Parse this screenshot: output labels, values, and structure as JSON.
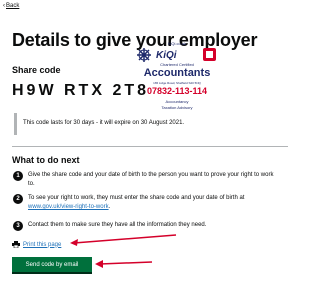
{
  "nav": {
    "back_label": "Back"
  },
  "page": {
    "title": "Details to give your employer",
    "share_code_label": "Share code",
    "share_code": "H9W RTX 2T8",
    "validity": "This code lasts for 30 days - it will expire on 30 August 2021."
  },
  "next": {
    "heading": "What to do next",
    "steps": [
      {
        "number": "1",
        "text": "Give the share code and your date of birth to the person you want to prove your right to work to."
      },
      {
        "number": "2",
        "text_before": "To see your right to work, they must enter the share code and your date of birth at ",
        "link": "www.gov.uk/view-right-to-work",
        "text_after": "."
      },
      {
        "number": "3",
        "text": "Contact them to make sure they have all the information they need."
      }
    ]
  },
  "actions": {
    "print_label": "Print this page",
    "print_icon": "printer-icon",
    "send_label": "Send code by email",
    "send_color": "#00703c"
  },
  "watermark": {
    "site": "KiQi.co.uk",
    "name": "KiQi",
    "subtitle": "Chartered Certified",
    "title": "Accountants",
    "address": "165 Lidge Road, Sheffield S20 5NQ",
    "phone": "07832-113-114",
    "tagline": "Accountancy",
    "tagline2": "Taxation Advisory",
    "colors": {
      "navy": "#1f2a6b",
      "red": "#d4002a"
    }
  },
  "colors": {
    "link": "#1d70b8",
    "text": "#0b0c0c",
    "arrow": "#d4002a"
  }
}
